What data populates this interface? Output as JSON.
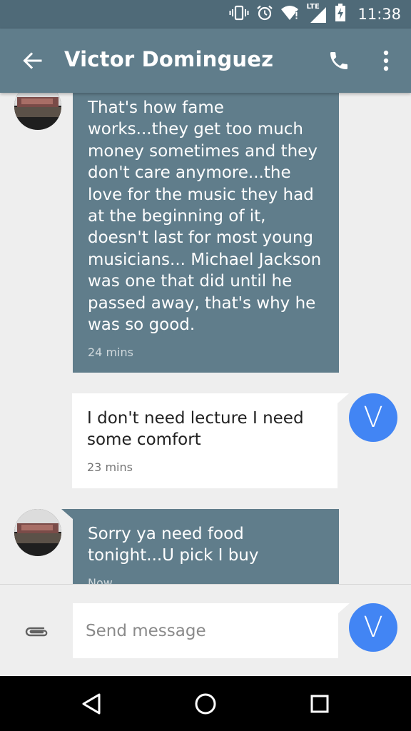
{
  "status_bar": {
    "time": "11:38",
    "network_label": "LTE"
  },
  "header": {
    "title": "Victor Dominguez"
  },
  "messages": [
    {
      "direction": "incoming",
      "text": "That's how fame works...they get too much money sometimes and they don't care anymore...the love for the music they had at the beginning of it,  doesn't last for most young musicians... Michael Jackson was one that did until he passed away, that's why he was so good.",
      "time": "24 mins"
    },
    {
      "direction": "outgoing",
      "text": "I don't need lecture I need some comfort",
      "time": "23 mins",
      "avatar_letter": "V"
    },
    {
      "direction": "incoming",
      "text": "Sorry ya need food tonight...U pick I buy",
      "time": "Now"
    }
  ],
  "compose": {
    "placeholder": "Send message",
    "send_letter": "V"
  },
  "colors": {
    "status_bar": "#4f6a78",
    "app_bar": "#607d8b",
    "incoming_bubble": "#607d8b",
    "outgoing_bubble": "#ffffff",
    "avatar_blue": "#4285f4",
    "background": "#eeeeee"
  }
}
